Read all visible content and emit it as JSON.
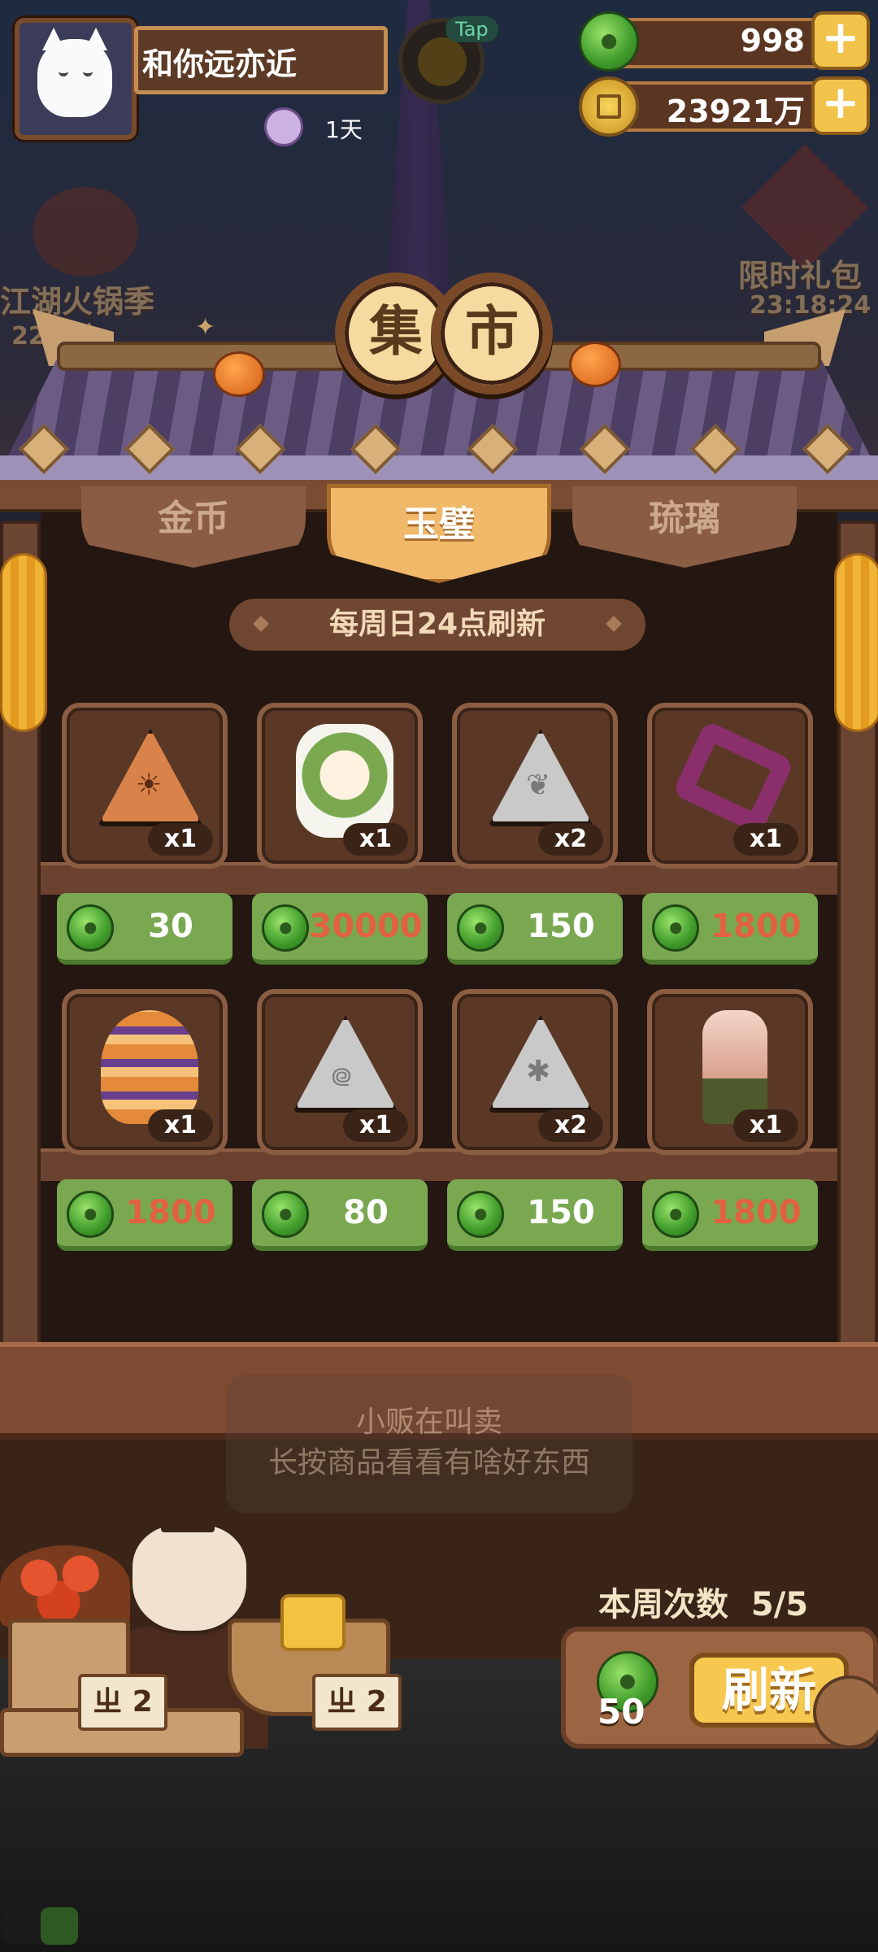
{
  "header": {
    "player_name": "和你远亦近",
    "days_label": "1天",
    "tap_label": "Tap",
    "jade_amount": "998",
    "coin_amount": "23921万"
  },
  "background": {
    "left_event_label": "江湖火锅季",
    "left_event_timer": "22小时",
    "right_event_label": "限时礼包",
    "right_event_timer": "23:18:24"
  },
  "market": {
    "title_chars": [
      "集",
      "市"
    ],
    "tabs": [
      {
        "label": "金币",
        "active": false
      },
      {
        "label": "玉璧",
        "active": true
      },
      {
        "label": "琉璃",
        "active": false
      }
    ],
    "refresh_note": "每周日24点刷新"
  },
  "items": [
    {
      "icon": "sun-rune-triangle",
      "qty": "x1",
      "price": "30",
      "price_color": "#ffffff"
    },
    {
      "icon": "green-hair-girl-character",
      "qty": "x1",
      "price": "30000",
      "price_color": "#e2613f"
    },
    {
      "icon": "leaf-rune-triangle",
      "qty": "x2",
      "price": "150",
      "price_color": "#ffffff"
    },
    {
      "icon": "purple-saw-tool",
      "qty": "x1",
      "price": "1800",
      "price_color": "#e2613f"
    },
    {
      "icon": "ornate-incense-jar",
      "qty": "x1",
      "price": "1800",
      "price_color": "#e2613f"
    },
    {
      "icon": "spiral-rune-triangle",
      "qty": "x1",
      "price": "80",
      "price_color": "#ffffff"
    },
    {
      "icon": "bug-rune-triangle",
      "qty": "x2",
      "price": "150",
      "price_color": "#ffffff"
    },
    {
      "icon": "lotus-lantern",
      "qty": "x1",
      "price": "1800",
      "price_color": "#e2613f"
    }
  ],
  "tooltip": {
    "line1": "小贩在叫卖",
    "line2": "长按商品看看有啥好东西"
  },
  "refresh": {
    "weekly_label": "本周次数",
    "weekly_count": "5/5",
    "cost": "50",
    "button_label": "刷新"
  },
  "stall": {
    "sign_left": "ㄓ 2",
    "sign_right": "ㄓ 2"
  }
}
